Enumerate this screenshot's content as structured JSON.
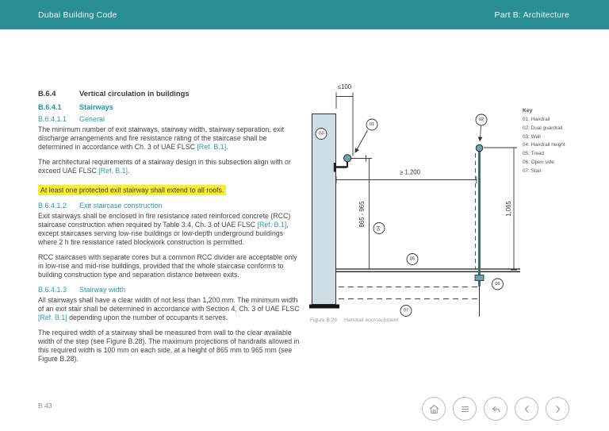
{
  "header": {
    "left_title": "Dubai Building Code",
    "right_title": "Part B: Architecture"
  },
  "article": {
    "h_644": {
      "code": "B.6.4",
      "title": "Vertical circulation in buildings"
    },
    "h_6441": {
      "code": "B.6.4.1",
      "title": "Stairways"
    },
    "h_64411": {
      "code": "B.6.4.1.1",
      "title": "General"
    },
    "p1": [
      "The minimum number of exit stairways, stairway width, stairway separation, exit discharge arrangements and fire resistance rating of the staircase shall be determined in accordance with Ch. 3 of UAE FLSC ",
      "[Ref. B.1]",
      "."
    ],
    "p2": [
      "The architectural requirements of a stairway design in this subsection align with or exceed UAE FLSC ",
      "[Ref. B.1]",
      "."
    ],
    "highlight": "At least one protected exit stairway shall extend to all roofs.",
    "h_64412": {
      "code": "B.6.4.1.2",
      "title": "Exit staircase construction"
    },
    "p3": [
      "Exit stairways shall be enclosed in fire resistance rated reinforced concrete (RCC) staircase construction when required by Table 3.4, Ch. 3 of UAE FLSC ",
      "[Ref. B.1]",
      ", except staircases serving low-rise buildings or low-depth underground buildings where 2 h fire resistance rated blockwork construction is permitted."
    ],
    "p4": "RCC staircases with separate cores but a common RCC divider are acceptable only in low-rise and mid-rise buildings, provided that the whole staircase conforms to building construction type and separation distance between exits.",
    "h_64413": {
      "code": "B.6.4.1.3",
      "title": "Stairway width"
    },
    "p5": [
      "All stairways shall have a clear width of not less than 1,200 mm. The minimum width of an exit stair shall be determined in accordance with Section 4, Ch. 3 of UAE FLSC ",
      "[Ref. B.1]",
      " depending upon the number of occupants it serves."
    ],
    "p6": "The required width of a stairway shall be measured from wall to the clear available width of the step (see Figure B.28). The maximum projections of handrails allowed in this required width is 100 mm on each side, at a height of 865 mm to 965 mm (see Figure B.28)."
  },
  "figure": {
    "caption_label": "Figure B.28",
    "caption_text": "Handrail encroachment",
    "dims": {
      "handrail_projection": "≤100",
      "clear_width": "≥ 1,200",
      "handrail_height": "865 - 965",
      "guardrail_height": "1,065"
    },
    "callouts": {
      "c01": "01",
      "c02": "02",
      "c03": "03",
      "c04": "04",
      "c05": "05",
      "c06": "06",
      "c07": "07"
    },
    "key": {
      "title": "Key",
      "items": [
        "01: Handrail",
        "02: Dual guardrail",
        "03: Wall",
        "04: Handrail height",
        "05: Tread",
        "06: Open side",
        "07: Stair"
      ]
    }
  },
  "footer": {
    "page_number": "B 43",
    "nav_icons": [
      "home",
      "contents",
      "back",
      "previous",
      "next"
    ]
  },
  "colors": {
    "header_teal": "#2a8e95",
    "accent_teal": "#2397a3",
    "highlight_yellow": "#f9ed32",
    "wall_fill": "#ccdee4",
    "fitting_teal": "#6fa3ad"
  }
}
